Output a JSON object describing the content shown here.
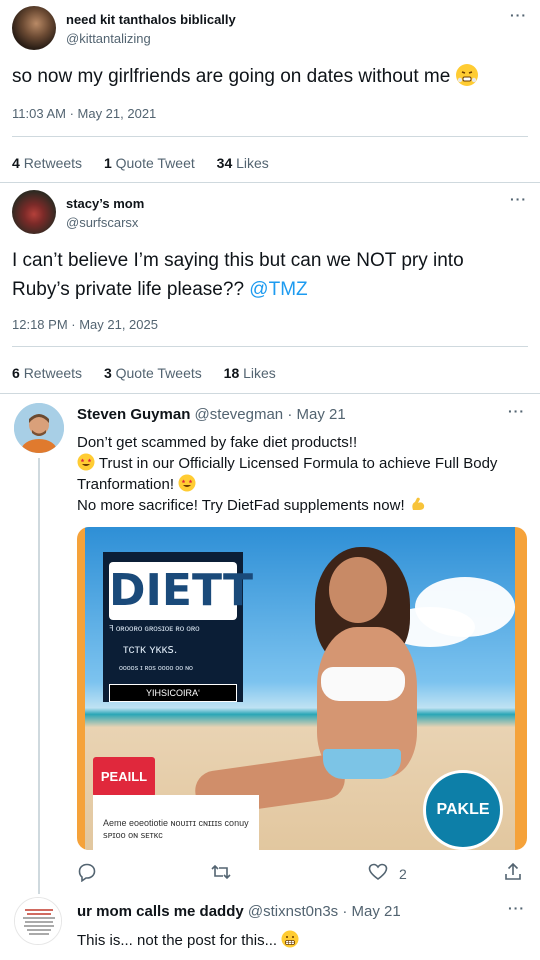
{
  "tweet1": {
    "name": "need kit tanthalos biblically",
    "handle": "@kittantalizing",
    "text": "so now my girlfriends are going on dates without me",
    "timestamp": "11:03 AM · May 21, 2021",
    "retweets_count": "4",
    "retweets_label": "Retweets",
    "quotes_count": "1",
    "quotes_label": "Quote Tweet",
    "likes_count": "34",
    "likes_label": "Likes",
    "more_icon": "more-dots-icon"
  },
  "tweet2": {
    "name": "stacy’s mom",
    "handle": "@surfscarsx",
    "text_before": "I can’t believe I’m saying this but can we NOT pry into Ruby’s private life please??",
    "mention": "@TMZ",
    "timestamp": "12:18 PM · May 21, 2025",
    "retweets_count": "6",
    "retweets_label": "Retweets",
    "quotes_count": "3",
    "quotes_label": "Quote Tweets",
    "likes_count": "18",
    "likes_label": "Likes"
  },
  "tweet3": {
    "name": "Steven Guyman",
    "handle": "@stevegman",
    "date": "· May 21",
    "line1": "Don’t get scammed by fake diet products!!",
    "line2": "Trust in our Officially Licensed Formula to achieve Full Body Tranformation!",
    "line3": "No more sacrifice! Try DietFad supplements now!",
    "ad": {
      "logo": "DIETT",
      "subline1": "ꟻ ᴏʀᴏᴏʀᴏ ɢʀᴏꜱɪᴏᴇ ʀᴏ ᴏʀᴏ",
      "subline2": "ᴛᴄᴛᴋ ʏᴋᴋꜱ.",
      "subline3": "ᴏᴏᴏᴏꜱ ɪ ʀᴏꜱ ᴏᴏᴏᴏ ᴏᴏ ɴᴏ",
      "bar_text": "YIHSICOIRAʻ",
      "red_label": "PEAILL",
      "bottom_text": "Aeme eoeotiotie ɴᴏᴜɪᴛɪ ᴄɴɪɪɪs conuy ꜱᴘɪᴏᴏ ᴏɴ ꜱᴇᴛᴋᴄ",
      "badge": "PAKLE"
    },
    "likes_count": "2"
  },
  "tweet4": {
    "name": "ur mom calls me daddy",
    "handle": "@stixnst0n3s",
    "date": "· May 21",
    "text": "This is... not the post for this..."
  }
}
